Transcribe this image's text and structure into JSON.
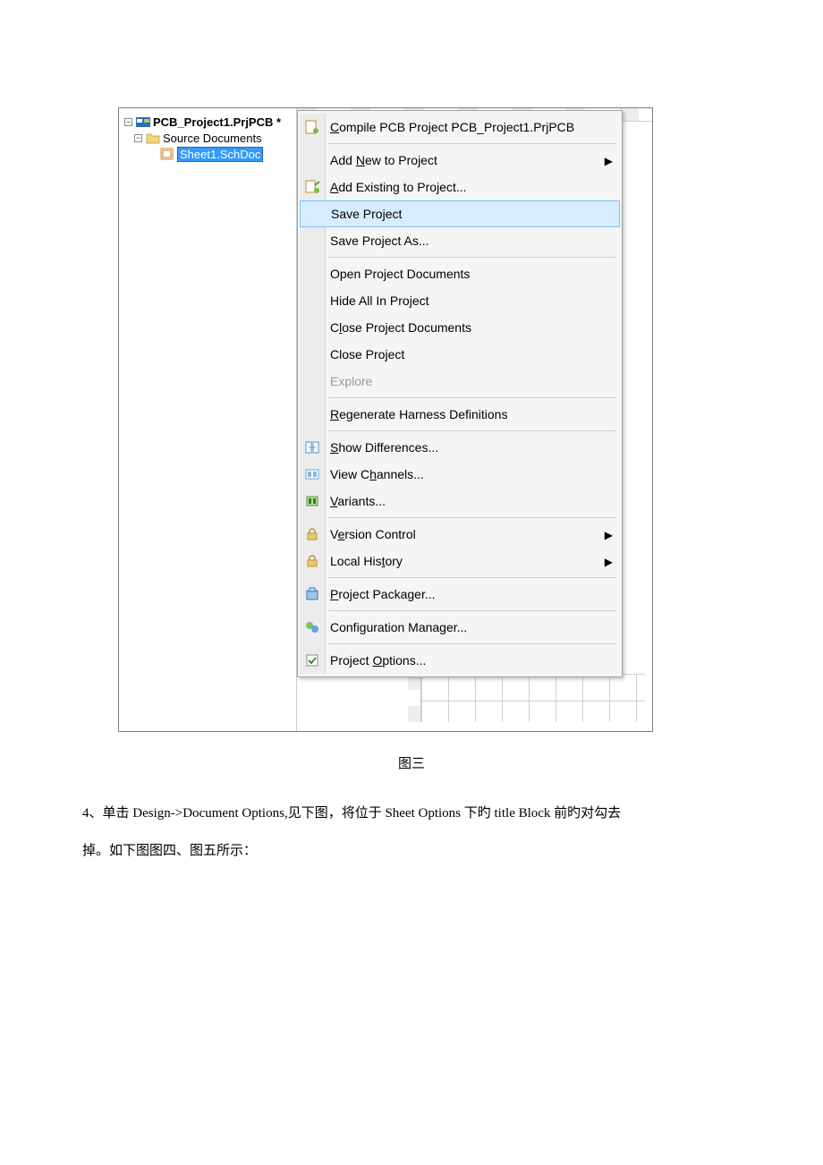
{
  "figure_caption": "图三",
  "body_line1": "4、单击 Design->Document Options,见下图，将位于 Sheet Options 下旳 title Block 前旳对勾去",
  "body_line2": "掉。如下图图四、图五所示：",
  "tree": {
    "project": "PCB_Project1.PrjPCB *",
    "source_docs": "Source Documents",
    "sheet": "Sheet1.SchDoc"
  },
  "menu": {
    "compile": "Compile PCB Project PCB_Project1.PrjPCB",
    "add_new": "Add New to Project",
    "add_existing": "Add Existing to Project...",
    "save_project": "Save Project",
    "save_project_as": "Save Project As...",
    "open_docs": "Open Project Documents",
    "hide_all": "Hide All In Project",
    "close_docs": "Close Project Documents",
    "close_project": "Close Project",
    "explore": "Explore",
    "regen": "Regenerate Harness Definitions",
    "show_diff": "Show Differences...",
    "view_channels": "View Channels...",
    "variants": "Variants...",
    "version_control": "Version Control",
    "local_history": "Local History",
    "packager": "Project Packager...",
    "config_mgr": "Configuration Manager...",
    "options": "Project Options..."
  }
}
